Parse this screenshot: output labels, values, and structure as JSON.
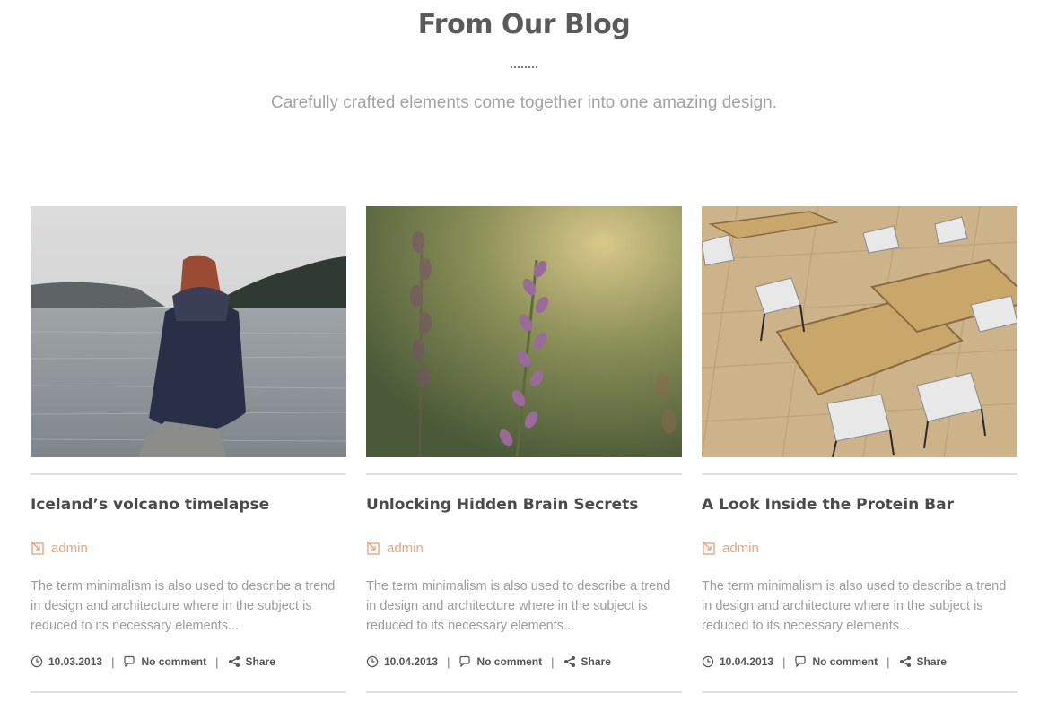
{
  "header": {
    "title": "From Our Blog",
    "subtitle": "Carefully crafted elements come together into one amazing design."
  },
  "colors": {
    "accent": "#e6a582",
    "title": "#4a4a4a",
    "muted": "#9c9c9c",
    "rule": "#dedede"
  },
  "posts": [
    {
      "title": "Iceland’s volcano timelapse",
      "author": "admin",
      "excerpt": "The term minimalism is also used to describe a trend in design and architecture where in the subject is reduced to its necessary elements...",
      "date": "10.03.2013",
      "comments": "No comment",
      "share": "Share",
      "image_icon": "woman-by-lake-photo"
    },
    {
      "title": "Unlocking Hidden Brain Secrets",
      "author": "admin",
      "excerpt": "The term minimalism is also used to describe a trend in design and architecture where in the subject is reduced to its necessary elements...",
      "date": "10.04.2013",
      "comments": "No comment",
      "share": "Share",
      "image_icon": "lavender-flower-photo"
    },
    {
      "title": "A Look Inside the Protein Bar",
      "author": "admin",
      "excerpt": "The term minimalism is also used to describe a trend in design and architecture where in the subject is reduced to its necessary elements...",
      "date": "10.04.2013",
      "comments": "No comment",
      "share": "Share",
      "image_icon": "cafe-tables-photo"
    }
  ]
}
